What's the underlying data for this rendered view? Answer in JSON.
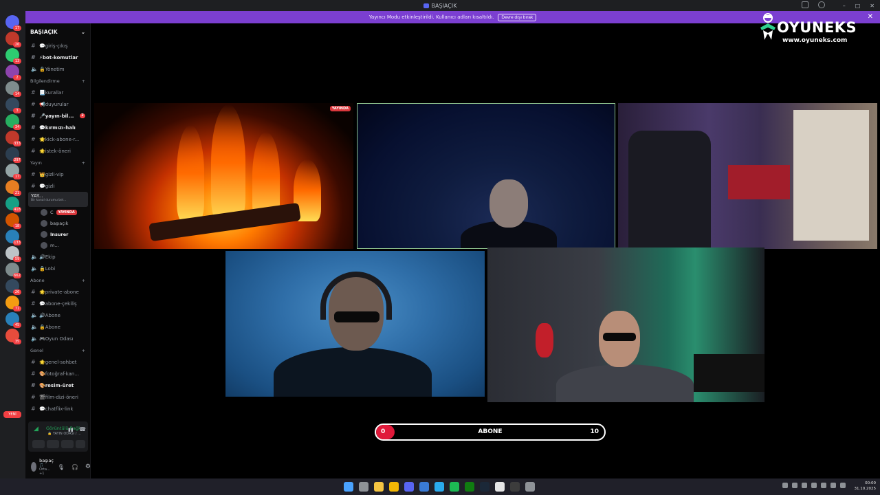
{
  "window": {
    "title": "BAŞIAÇIK",
    "controls": [
      "–",
      "□",
      "✕"
    ]
  },
  "banner": {
    "message": "Yayıncı Modu etkinleştirildi. Kullanıcı adları kısaltıldı.",
    "button_label": "Devre dışı bırak",
    "close_label": "✕"
  },
  "rail": {
    "badges": [
      "17",
      "26",
      "13",
      "2",
      "14",
      "3",
      "34",
      "333",
      "297",
      "17",
      "21",
      "418",
      "18",
      "133",
      "59",
      "662",
      "26",
      "71",
      "45",
      "35"
    ],
    "new_label": "YENİ"
  },
  "sidebar": {
    "server_name": "BAŞIAÇIK",
    "top_channels": [
      {
        "name": "giriş-çıkış",
        "icon": "💬",
        "type": "text"
      },
      {
        "name": "bot-komutlar",
        "icon": "⚡",
        "type": "text",
        "bright": true
      },
      {
        "name": "Yönetim",
        "icon": "🔒",
        "type": "voice"
      }
    ],
    "cat_bilgi": "Bilgilendirme",
    "bilgi_channels": [
      {
        "name": "kurallar",
        "icon": "📃",
        "type": "text"
      },
      {
        "name": "duyurular",
        "icon": "📢",
        "type": "text"
      },
      {
        "name": "yayın-bil...",
        "icon": "🎤",
        "type": "text",
        "bright": true,
        "badge": "2"
      },
      {
        "name": "kırmızı-halı",
        "icon": "💬",
        "type": "text",
        "bright": true
      },
      {
        "name": "kick-abone-r...",
        "icon": "🌟",
        "type": "text"
      },
      {
        "name": "istek-öneri",
        "icon": "🌟",
        "type": "text"
      }
    ],
    "cat_yayin": "Yayın",
    "yayin_channels": [
      {
        "name": "gizli-vip",
        "icon": "👑",
        "type": "text"
      },
      {
        "name": "gizli",
        "icon": "💬",
        "type": "text"
      }
    ],
    "active_channel": {
      "name": "YAY...",
      "sub": "Bir kanal durumu bel..."
    },
    "voice_users": [
      {
        "name": "C",
        "live": "YAYINDA"
      },
      {
        "name": "başıaçık"
      },
      {
        "name": "Insurer",
        "bright": true
      },
      {
        "name": "m..."
      }
    ],
    "after_voice": [
      {
        "name": "Ekip",
        "icon": "🔊",
        "type": "voice"
      },
      {
        "name": "Lobi",
        "icon": "🔒",
        "type": "voice"
      }
    ],
    "cat_abone": "Abone",
    "abone_channels": [
      {
        "name": "private-abone",
        "icon": "🌟",
        "type": "text"
      },
      {
        "name": "abone-çekiliş",
        "icon": "💬",
        "type": "text"
      },
      {
        "name": "Abone",
        "icon": "🔊",
        "type": "voice"
      },
      {
        "name": "Abone",
        "icon": "🔒",
        "type": "voice"
      },
      {
        "name": "Oyun Odası",
        "icon": "🎮",
        "type": "voice"
      }
    ],
    "cat_genel": "Genel",
    "genel_channels": [
      {
        "name": "genel-sohbet",
        "icon": "🌟",
        "type": "text"
      },
      {
        "name": "fotoğraf-kan...",
        "icon": "🎨",
        "type": "text"
      },
      {
        "name": "resim-üret",
        "icon": "🎨",
        "type": "text",
        "bright": true
      },
      {
        "name": "film-dizi-öneri",
        "icon": "🎬",
        "type": "text"
      },
      {
        "name": "chatflix-link",
        "icon": "💬",
        "type": "text"
      }
    ],
    "voice_panel": {
      "status": "Görüntülü Bağl",
      "channel": "🔒 YAYIN ODASI / ..."
    },
    "user": {
      "name": "başıaçık",
      "status": "🎵 Orta... +1"
    }
  },
  "video": {
    "fire_badge": "YAYINDA"
  },
  "goal": {
    "current": "0",
    "label": "ABONE",
    "target": "10",
    "fill_fraction": 0.08,
    "fill_color": "#e0193a"
  },
  "brand": {
    "name": "OYUNEKS",
    "url": "www.oyuneks.com"
  },
  "taskbar": {
    "icons": [
      "windows-start",
      "search",
      "file-explorer",
      "chrome",
      "discord",
      "app-grid",
      "telegram",
      "spotify",
      "xbox",
      "steam",
      "notion",
      "obs",
      "settings"
    ],
    "time": "00:00",
    "date": "31.10.2025"
  },
  "colors": {
    "accent": "#7b3fd1",
    "live": "#da373c",
    "voice_connected": "#23a559"
  }
}
